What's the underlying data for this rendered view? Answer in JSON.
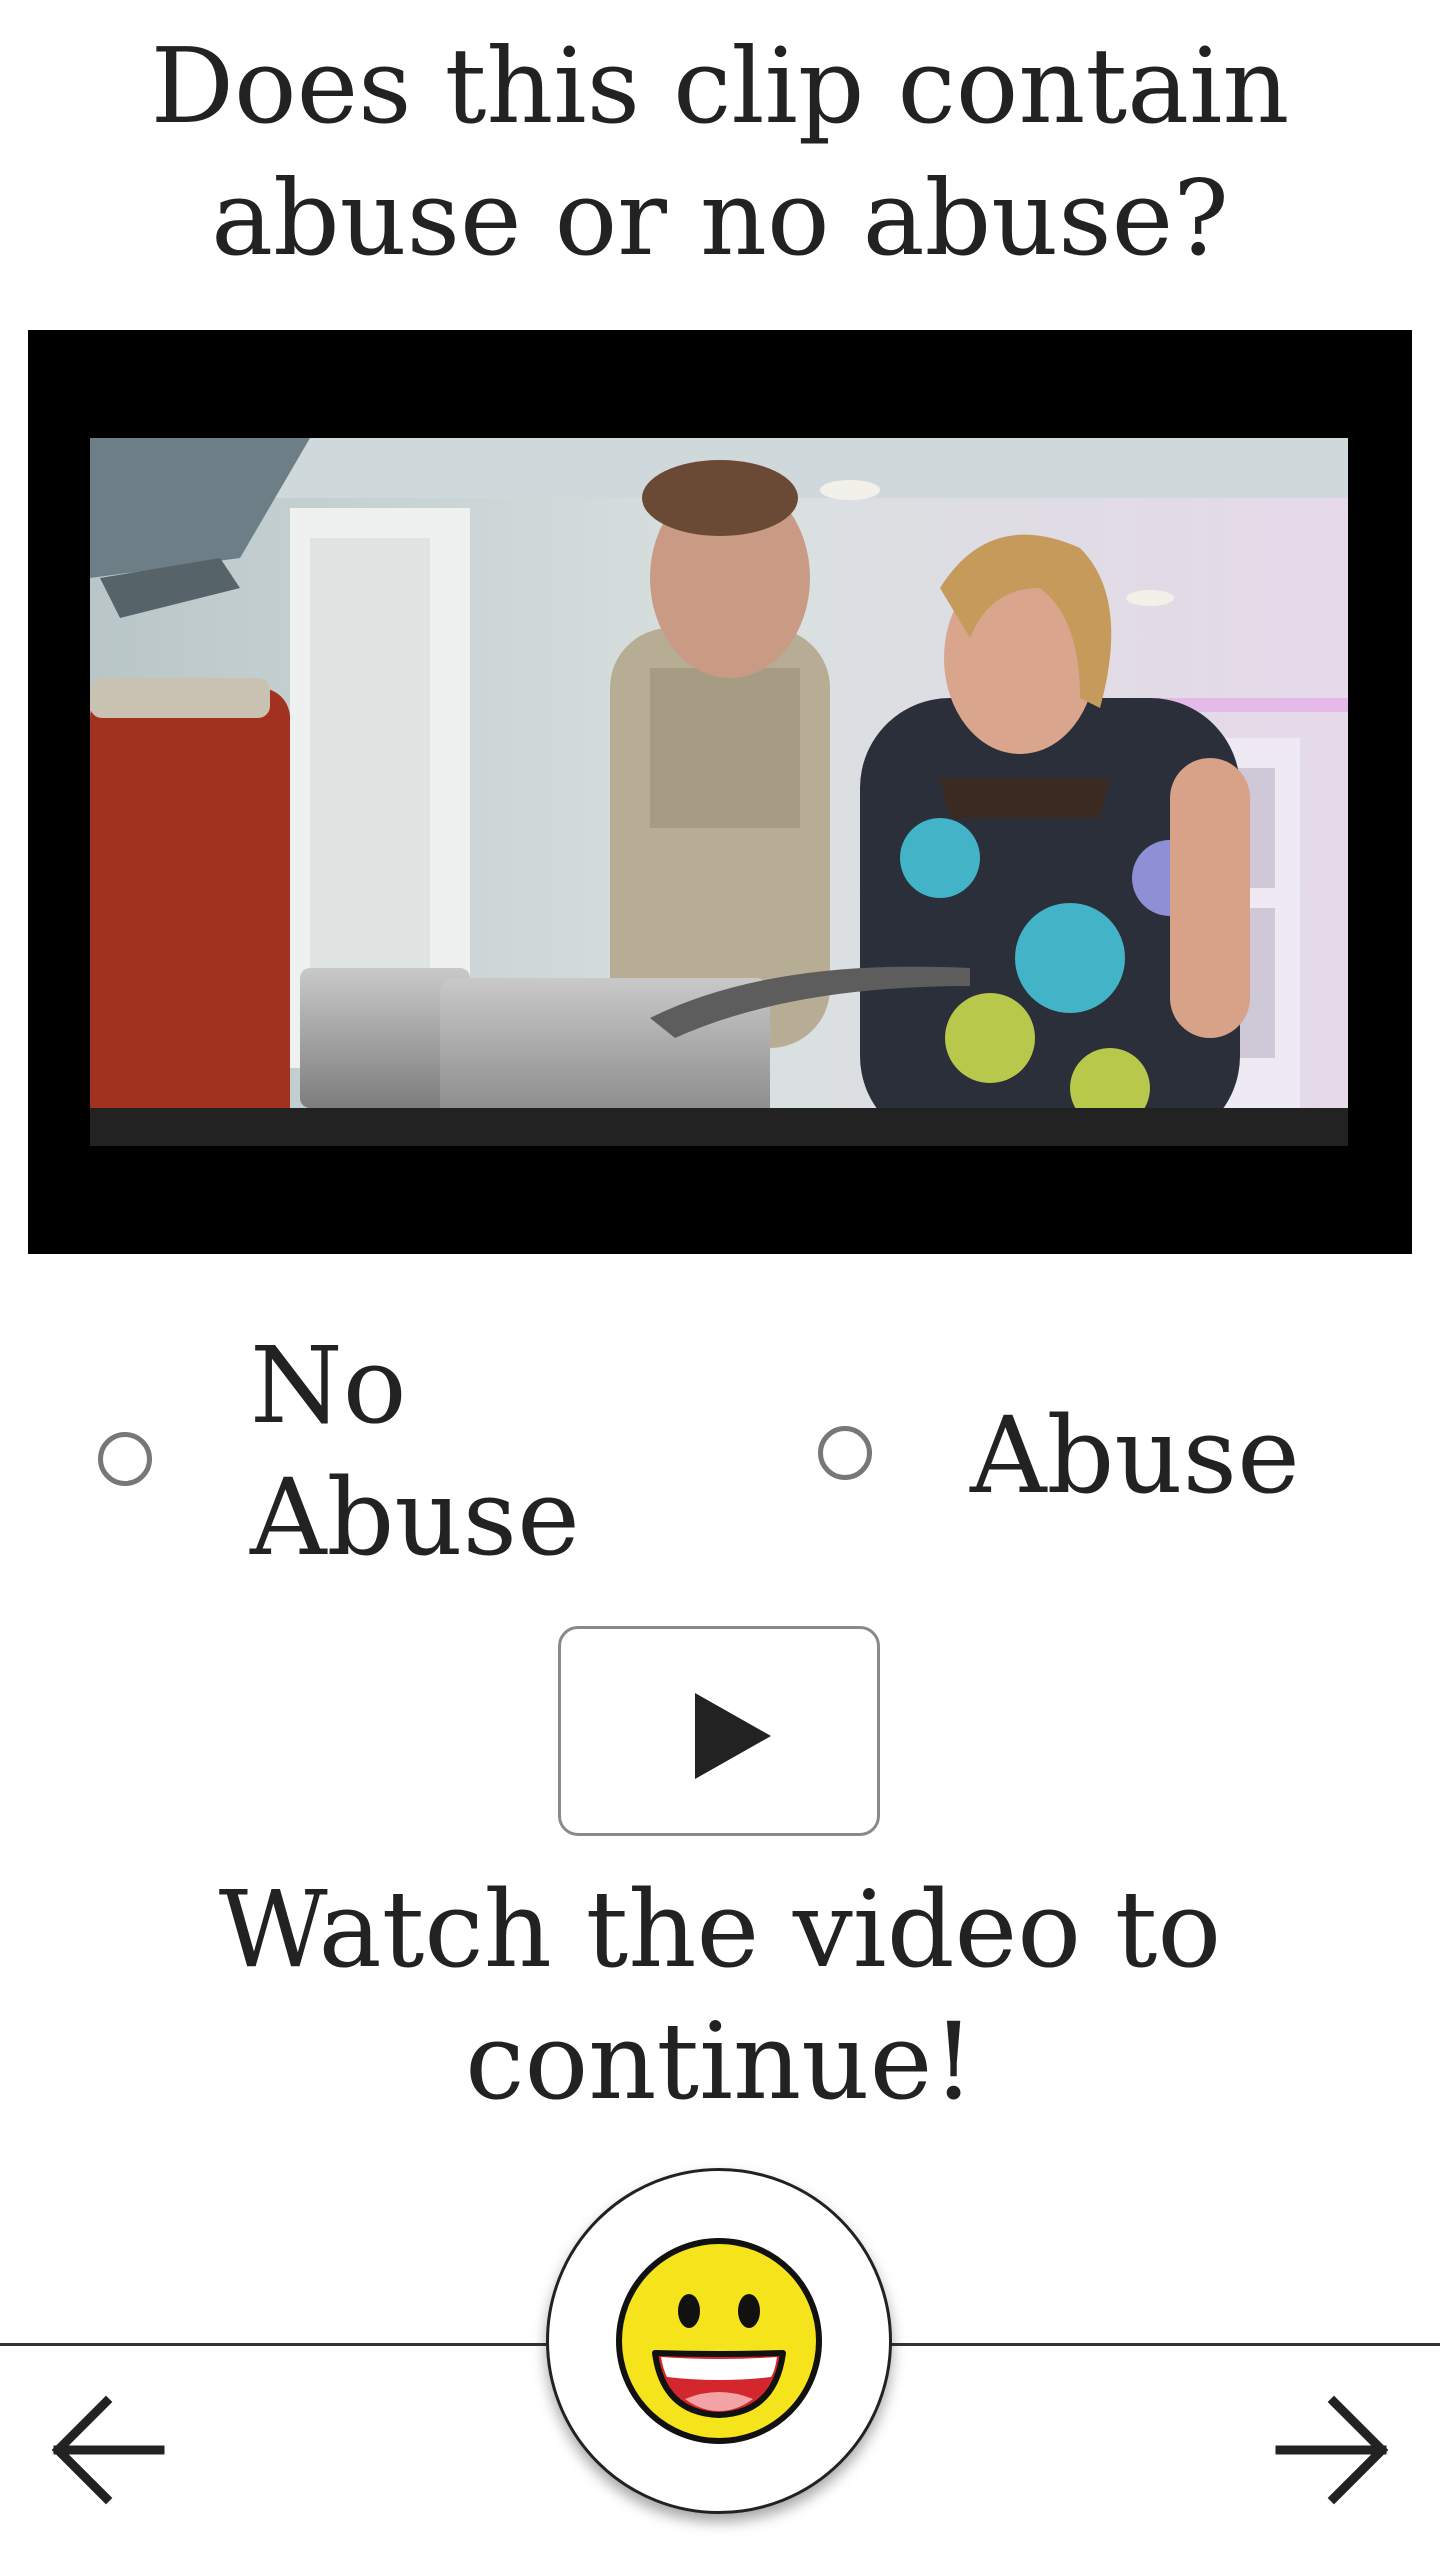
{
  "question": {
    "text": "Does this clip contain abuse or no abuse?"
  },
  "video": {
    "letterbox_color": "#000000"
  },
  "options": [
    {
      "label": "No Abuse",
      "selected": false
    },
    {
      "label": "Abuse",
      "selected": false
    }
  ],
  "controls": {
    "play_icon": "play-icon",
    "watch_message": "Watch the video to continue!"
  },
  "navigation": {
    "back_icon": "arrow-left-icon",
    "next_icon": "arrow-right-icon",
    "mascot_icon": "smiley-face-icon",
    "mascot_color": "#f5e31b"
  }
}
